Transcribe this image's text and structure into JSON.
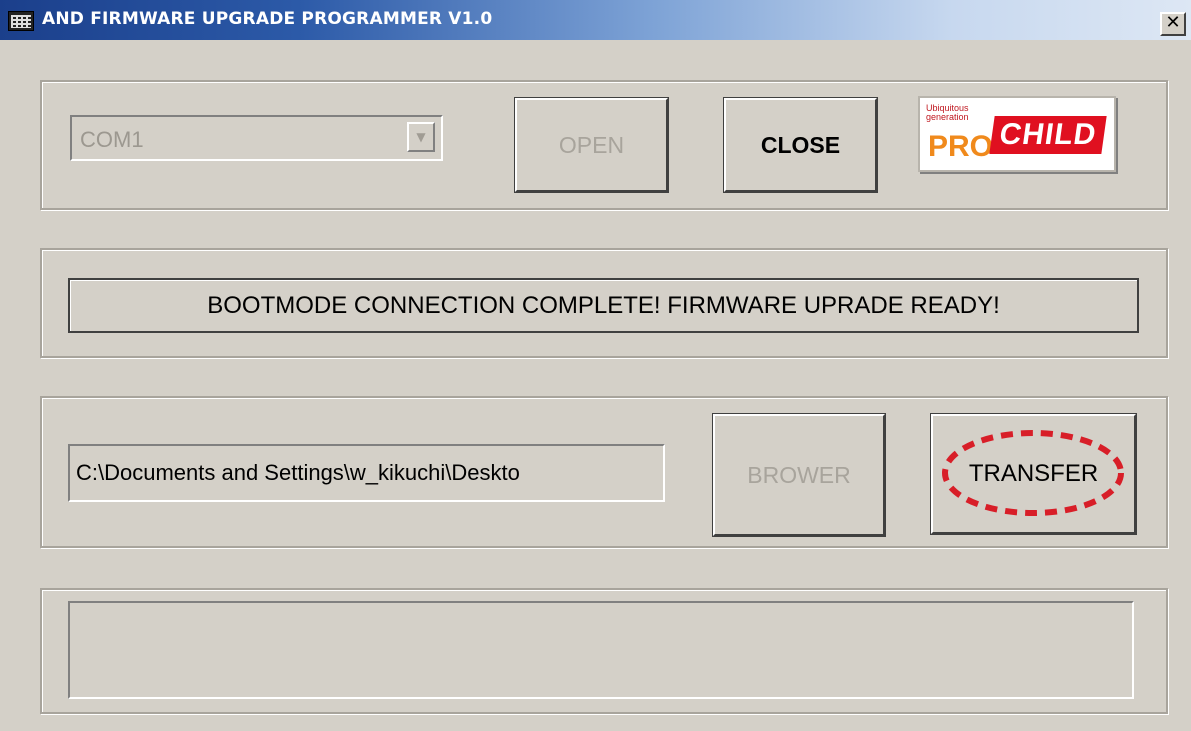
{
  "window": {
    "title": "AND FIRMWARE UPGRADE PROGRAMMER V1.0",
    "close_glyph": "✕"
  },
  "connection": {
    "port_value": "COM1",
    "open_label": "OPEN",
    "close_label": "CLOSE"
  },
  "logo": {
    "tagline": "Ubiquitous generation",
    "pro": "PRO",
    "child": "CHILD"
  },
  "status": {
    "message": "BOOTMODE CONNECTION COMPLETE! FIRMWARE UPRADE READY!"
  },
  "file": {
    "path_value": "C:\\Documents and Settings\\w_kikuchi\\Deskto",
    "brower_label": "BROWER",
    "transfer_label": "TRANSFER"
  },
  "log": {
    "text": ""
  },
  "icons": {
    "app": "app-grid-icon",
    "dropdown": "chevron-down-icon",
    "close": "close-icon"
  },
  "colors": {
    "title_bar_start": "#1b3f8b",
    "title_bar_end": "#dde7f4",
    "face": "#d4d0c8",
    "disabled_text": "#a8a49c",
    "highlight_ring": "#d81e28",
    "logo_red": "#e01020",
    "logo_orange": "#f08a1c"
  }
}
